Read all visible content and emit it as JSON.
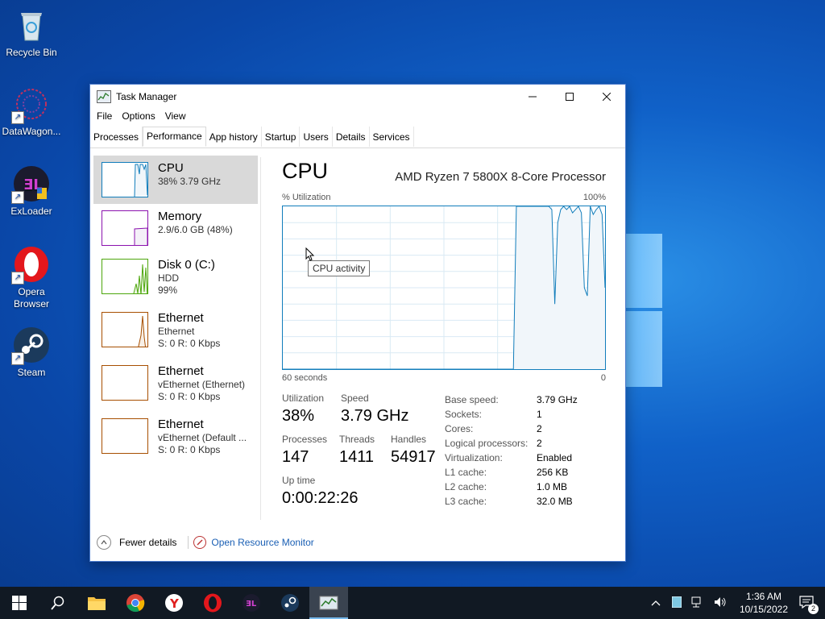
{
  "desktop": {
    "icons": [
      {
        "label": "Recycle Bin"
      },
      {
        "label": "DataWagon..."
      },
      {
        "label": "ExLoader"
      },
      {
        "label": "Opera Browser"
      },
      {
        "label": "Steam"
      }
    ]
  },
  "window": {
    "title": "Task Manager",
    "menu": [
      "File",
      "Options",
      "View"
    ],
    "tabs": [
      "Processes",
      "Performance",
      "App history",
      "Startup",
      "Users",
      "Details",
      "Services"
    ],
    "active_tab": "Performance"
  },
  "sidebar": {
    "items": [
      {
        "name": "CPU",
        "line1": "38%  3.79 GHz",
        "line2": "",
        "color": "#117dbb",
        "selected": true
      },
      {
        "name": "Memory",
        "line1": "2.9/6.0 GB (48%)",
        "line2": "",
        "color": "#8b12ae"
      },
      {
        "name": "Disk 0 (C:)",
        "line1": "HDD",
        "line2": "99%",
        "color": "#4da60c"
      },
      {
        "name": "Ethernet",
        "line1": "Ethernet",
        "line2": "S: 0  R: 0 Kbps",
        "color": "#a74f01"
      },
      {
        "name": "Ethernet",
        "line1": "vEthernet (Ethernet)",
        "line2": "S: 0  R: 0 Kbps",
        "color": "#a74f01"
      },
      {
        "name": "Ethernet",
        "line1": "vEthernet (Default ...",
        "line2": "S: 0  R: 0 Kbps",
        "color": "#a74f01"
      }
    ]
  },
  "cpu": {
    "title": "CPU",
    "model": "AMD Ryzen 7 5800X 8-Core Processor",
    "y_label": "% Utilization",
    "y_max": "100%",
    "x_label": "60 seconds",
    "x_min": "0",
    "tooltip": "CPU activity",
    "utilization_label": "Utilization",
    "utilization": "38%",
    "speed_label": "Speed",
    "speed": "3.79 GHz",
    "processes_label": "Processes",
    "processes": "147",
    "threads_label": "Threads",
    "threads": "1411",
    "handles_label": "Handles",
    "handles": "54917",
    "uptime_label": "Up time",
    "uptime": "0:00:22:26",
    "specs": [
      {
        "k": "Base speed:",
        "v": "3.79 GHz"
      },
      {
        "k": "Sockets:",
        "v": "1"
      },
      {
        "k": "Cores:",
        "v": "2"
      },
      {
        "k": "Logical processors:",
        "v": "2"
      },
      {
        "k": "Virtualization:",
        "v": "Enabled"
      },
      {
        "k": "L1 cache:",
        "v": "256 KB"
      },
      {
        "k": "L2 cache:",
        "v": "1.0 MB"
      },
      {
        "k": "L3 cache:",
        "v": "32.0 MB"
      }
    ],
    "graph_series": [
      0,
      0,
      0,
      0,
      0,
      0,
      0,
      0,
      0,
      0,
      0,
      0,
      0,
      0,
      0,
      0,
      0,
      0,
      0,
      0,
      0,
      0,
      0,
      0,
      0,
      0,
      0,
      0,
      0,
      0,
      0,
      0,
      0,
      0,
      0,
      0,
      0,
      0,
      0,
      0,
      0,
      0,
      0,
      0,
      0,
      0,
      0,
      0,
      0,
      0,
      0,
      0,
      0,
      0,
      0,
      0,
      0,
      0,
      0,
      0,
      0,
      0,
      0,
      0,
      0,
      0,
      0,
      0,
      0,
      0,
      0,
      0,
      0,
      0,
      0,
      0,
      0,
      0,
      0,
      100,
      100,
      100,
      100,
      100,
      100,
      100,
      100,
      100,
      100,
      100,
      100,
      98,
      40,
      90,
      98,
      100,
      98,
      100,
      96,
      98,
      100,
      96,
      50,
      45,
      100,
      95,
      98,
      100,
      95,
      50
    ]
  },
  "footer": {
    "fewer_details": "Fewer details",
    "open_monitor": "Open Resource Monitor"
  },
  "taskbar": {
    "time": "1:36 AM",
    "date": "10/15/2022",
    "notifications": "2"
  }
}
